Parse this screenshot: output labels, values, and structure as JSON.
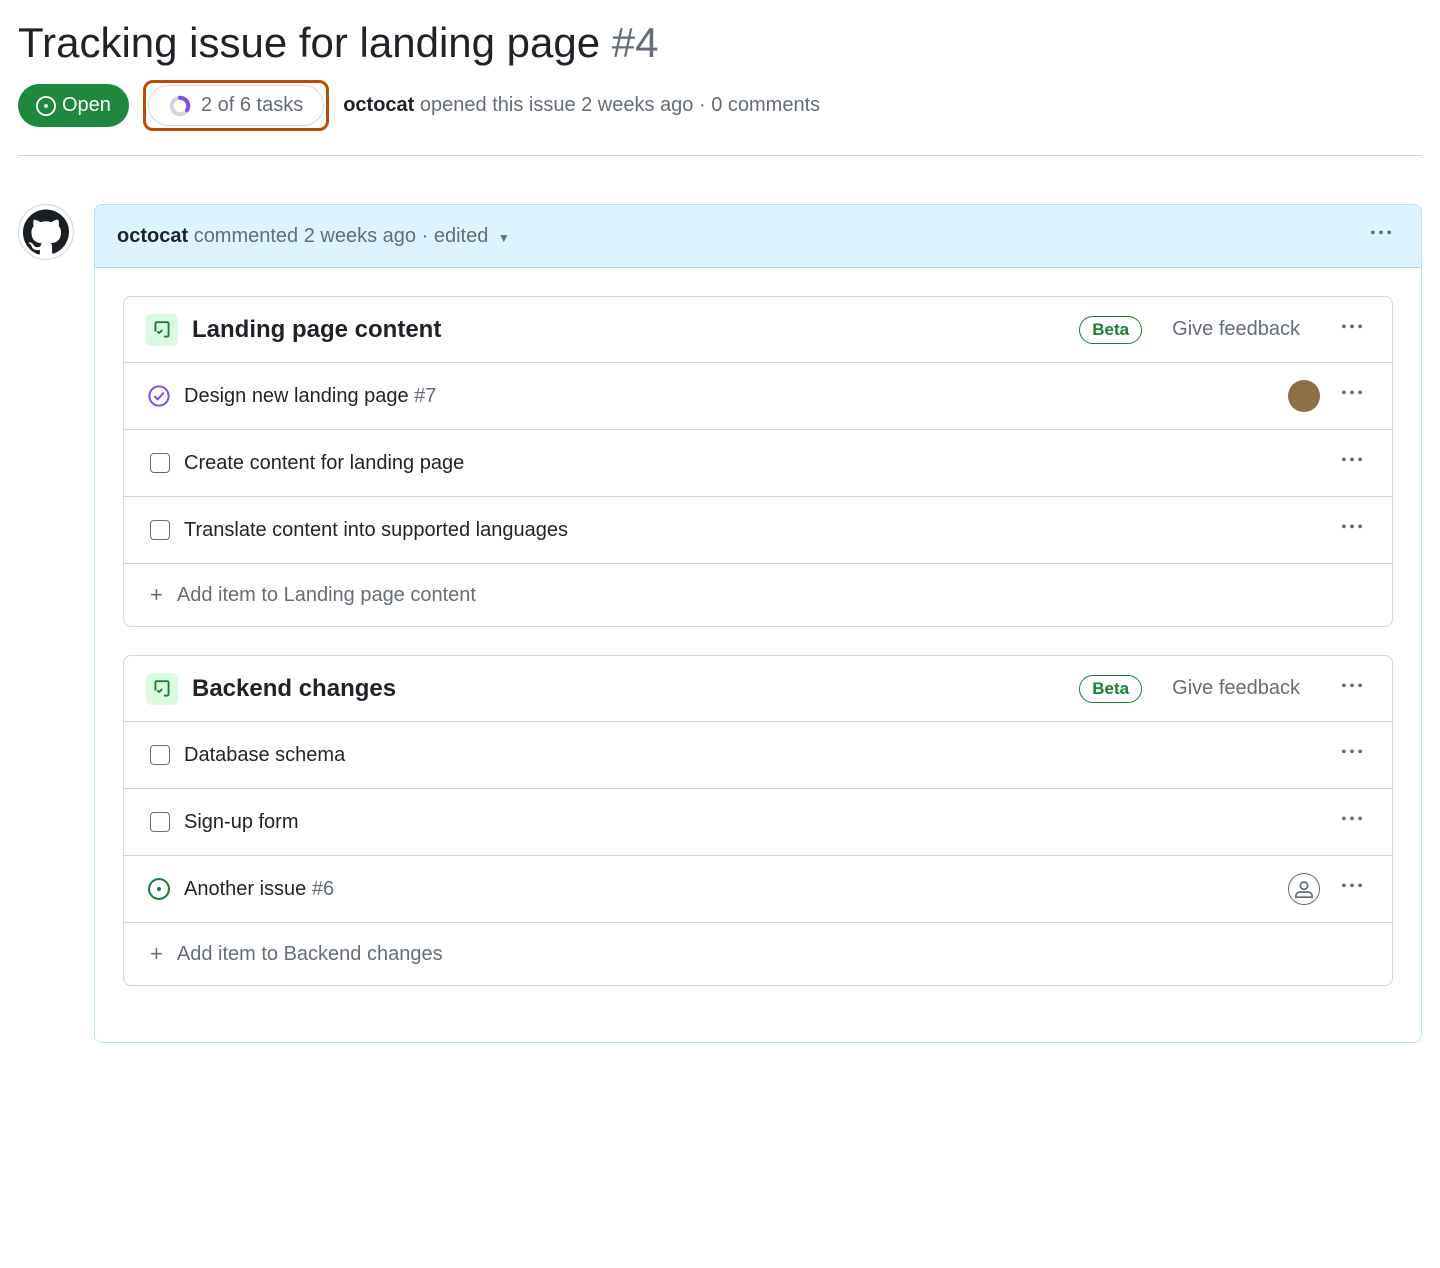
{
  "issue": {
    "title": "Tracking issue for landing page",
    "number": "#4",
    "status": "Open",
    "tasksSummary": "2 of 6 tasks",
    "author": "octocat",
    "openedText": "opened this issue 2 weeks ago",
    "commentsText": "0 comments"
  },
  "comment": {
    "author": "octocat",
    "action": "commented",
    "time": "2 weeks ago",
    "edited": "edited"
  },
  "tasklists": [
    {
      "title": "Landing page content",
      "beta": "Beta",
      "feedback": "Give feedback",
      "addText": "Add item to Landing page content",
      "items": [
        {
          "type": "issue",
          "status": "completed",
          "text": "Design new landing page",
          "ref": "#7",
          "assignee": true
        },
        {
          "type": "checkbox",
          "text": "Create content for landing page"
        },
        {
          "type": "checkbox",
          "text": "Translate content into supported languages"
        }
      ]
    },
    {
      "title": "Backend changes",
      "beta": "Beta",
      "feedback": "Give feedback",
      "addText": "Add item to Backend changes",
      "items": [
        {
          "type": "checkbox",
          "text": "Database schema"
        },
        {
          "type": "checkbox",
          "text": "Sign-up form"
        },
        {
          "type": "issue",
          "status": "open",
          "text": "Another issue",
          "ref": "#6",
          "unassigned": true
        }
      ]
    }
  ]
}
